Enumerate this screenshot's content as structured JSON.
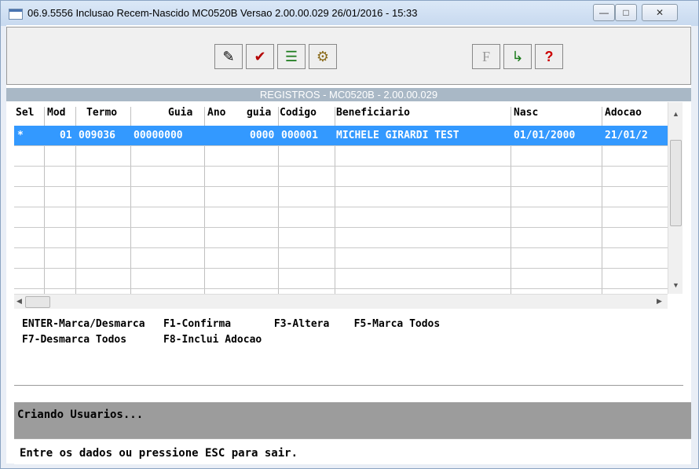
{
  "window": {
    "title": "06.9.5556 Inclusao Recem-Nascido MC0520B Versao 2.00.00.029 26/01/2016 - 15:33",
    "minimize": "—",
    "maximize": "□",
    "close": "✕"
  },
  "toolbar": {
    "buttons": [
      {
        "icon": "edit-paper-icon",
        "glyph": "✎"
      },
      {
        "icon": "checklist-icon",
        "glyph": "✔"
      },
      {
        "icon": "list-icon",
        "glyph": "☰"
      },
      {
        "icon": "gears-icon",
        "glyph": "⚙"
      },
      {
        "icon": "filter-icon",
        "glyph": "F"
      },
      {
        "icon": "exit-door-icon",
        "glyph": "↳"
      },
      {
        "icon": "help-icon",
        "glyph": "?"
      }
    ]
  },
  "section": {
    "title": "REGISTROS - MC0520B - 2.00.00.029"
  },
  "grid": {
    "columns": [
      "Sel",
      "Mod",
      "Termo",
      "Guia",
      "Ano",
      "guia",
      "Codigo",
      "Beneficiario",
      "Nasc",
      "Adocao"
    ],
    "rows": [
      {
        "sel": "*",
        "mod": "01",
        "termo": "009036",
        "guia": "00000000",
        "ano_guia": "0000",
        "codigo": "000001",
        "beneficiario": "MICHELE GIRARDI TEST",
        "nasc": "01/01/2000",
        "adocao": "21/01/2"
      }
    ]
  },
  "keys": {
    "line1": "ENTER-Marca/Desmarca   F1-Confirma       F3-Altera    F5-Marca Todos",
    "line2": "F7-Desmarca Todos      F8-Inclui Adocao"
  },
  "status": {
    "message": "Criando Usuarios...",
    "prompt": "Entre os dados ou pressione ESC para sair."
  }
}
